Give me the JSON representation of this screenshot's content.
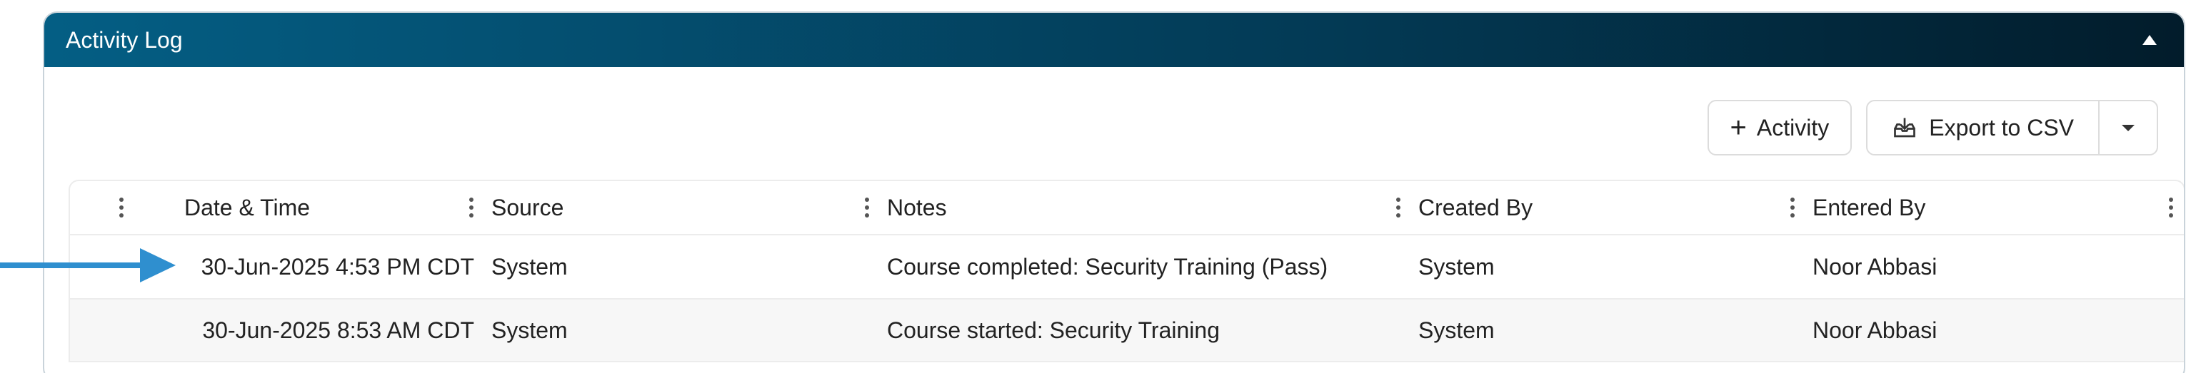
{
  "panel": {
    "title": "Activity Log"
  },
  "toolbar": {
    "add_activity_label": "Activity",
    "export_label": "Export to CSV"
  },
  "table": {
    "columns": [
      "Date & Time",
      "Source",
      "Notes",
      "Created By",
      "Entered By"
    ],
    "rows": [
      {
        "datetime": "30-Jun-2025 4:53 PM CDT",
        "source": "System",
        "notes": "Course completed: Security Training (Pass)",
        "created_by": "System",
        "entered_by": "Noor Abbasi"
      },
      {
        "datetime": "30-Jun-2025 8:53 AM CDT",
        "source": "System",
        "notes": "Course started: Security Training",
        "created_by": "System",
        "entered_by": "Noor Abbasi"
      }
    ]
  },
  "colors": {
    "header_start": "#045e84",
    "header_end": "#021c2b",
    "arrow": "#2f8fcf"
  },
  "icons": [
    "collapse-icon",
    "plus-icon",
    "export-icon",
    "chevron-down-icon",
    "column-menu-icon",
    "row-pointer-arrow-icon"
  ]
}
